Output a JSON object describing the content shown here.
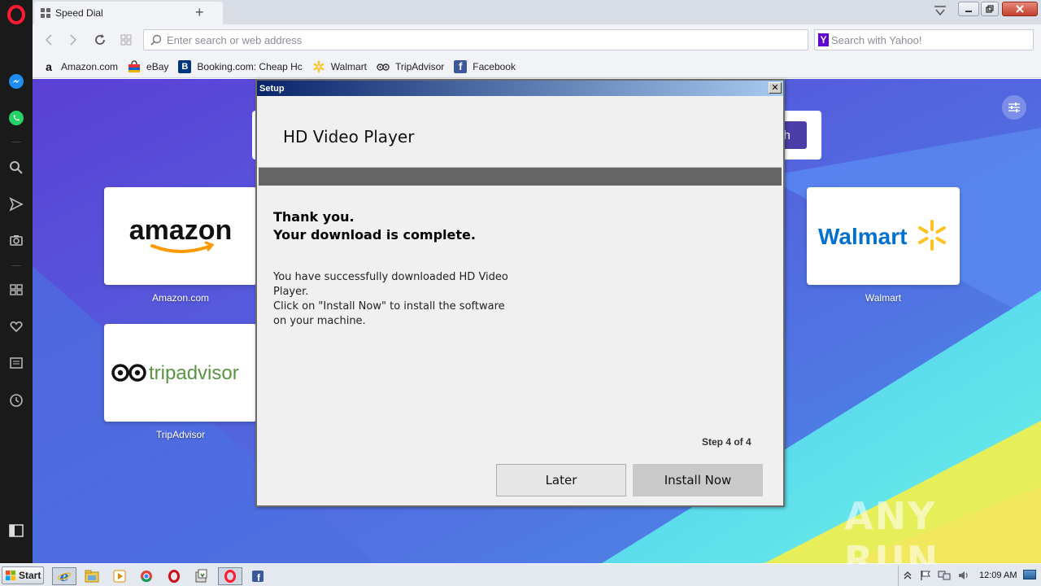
{
  "browser": {
    "tab": {
      "title": "Speed Dial"
    },
    "new_tab": "+",
    "address_placeholder": "Enter search or web address",
    "search_placeholder": "Search with Yahoo!",
    "search_engine_icon": "Y"
  },
  "bookmarks": [
    {
      "label": "Amazon.com",
      "icon": "amazon-icon",
      "color": "#ffffff"
    },
    {
      "label": "eBay",
      "icon": "ebay-bag-icon",
      "color": "#e53238"
    },
    {
      "label": "Booking.com: Cheap Hc",
      "icon": "booking-icon",
      "color": "#003580"
    },
    {
      "label": "Walmart",
      "icon": "walmart-spark-icon",
      "color": "#ffc220"
    },
    {
      "label": "TripAdvisor",
      "icon": "tripadvisor-owl-icon",
      "color": "#333333"
    },
    {
      "label": "Facebook",
      "icon": "facebook-icon",
      "color": "#3b5998"
    }
  ],
  "speed_dial": {
    "search_button_fragment": "ch",
    "tiles": [
      {
        "label": "Amazon.com",
        "logo_text": "amazon"
      },
      {
        "label": "TripAdvisor",
        "logo_text": "tripadvisor"
      },
      {
        "label": "Walmart",
        "logo_text": "Walmart"
      }
    ]
  },
  "dialog": {
    "title": "Setup",
    "close": "✕",
    "app_name": "HD Video Player",
    "heading_line1": "Thank you.",
    "heading_line2": "Your download is complete.",
    "message_line1": "You have successfully downloaded HD Video Player.",
    "message_line2": "Click on \"Install Now\" to install the software on your machine.",
    "step": "Step 4 of 4",
    "later_label": "Later",
    "install_label": "Install Now"
  },
  "watermark": "ANY RUN",
  "taskbar": {
    "start_label": "Start",
    "clock": "12:09 AM"
  },
  "colors": {
    "opera_red": "#ff1b2d",
    "dialog_title_start": "#0a246a",
    "dialog_title_end": "#a6caf0",
    "band": "#656565",
    "walmart_blue": "#0071ce",
    "walmart_yellow": "#ffc220",
    "amazon_orange": "#ff9900"
  }
}
